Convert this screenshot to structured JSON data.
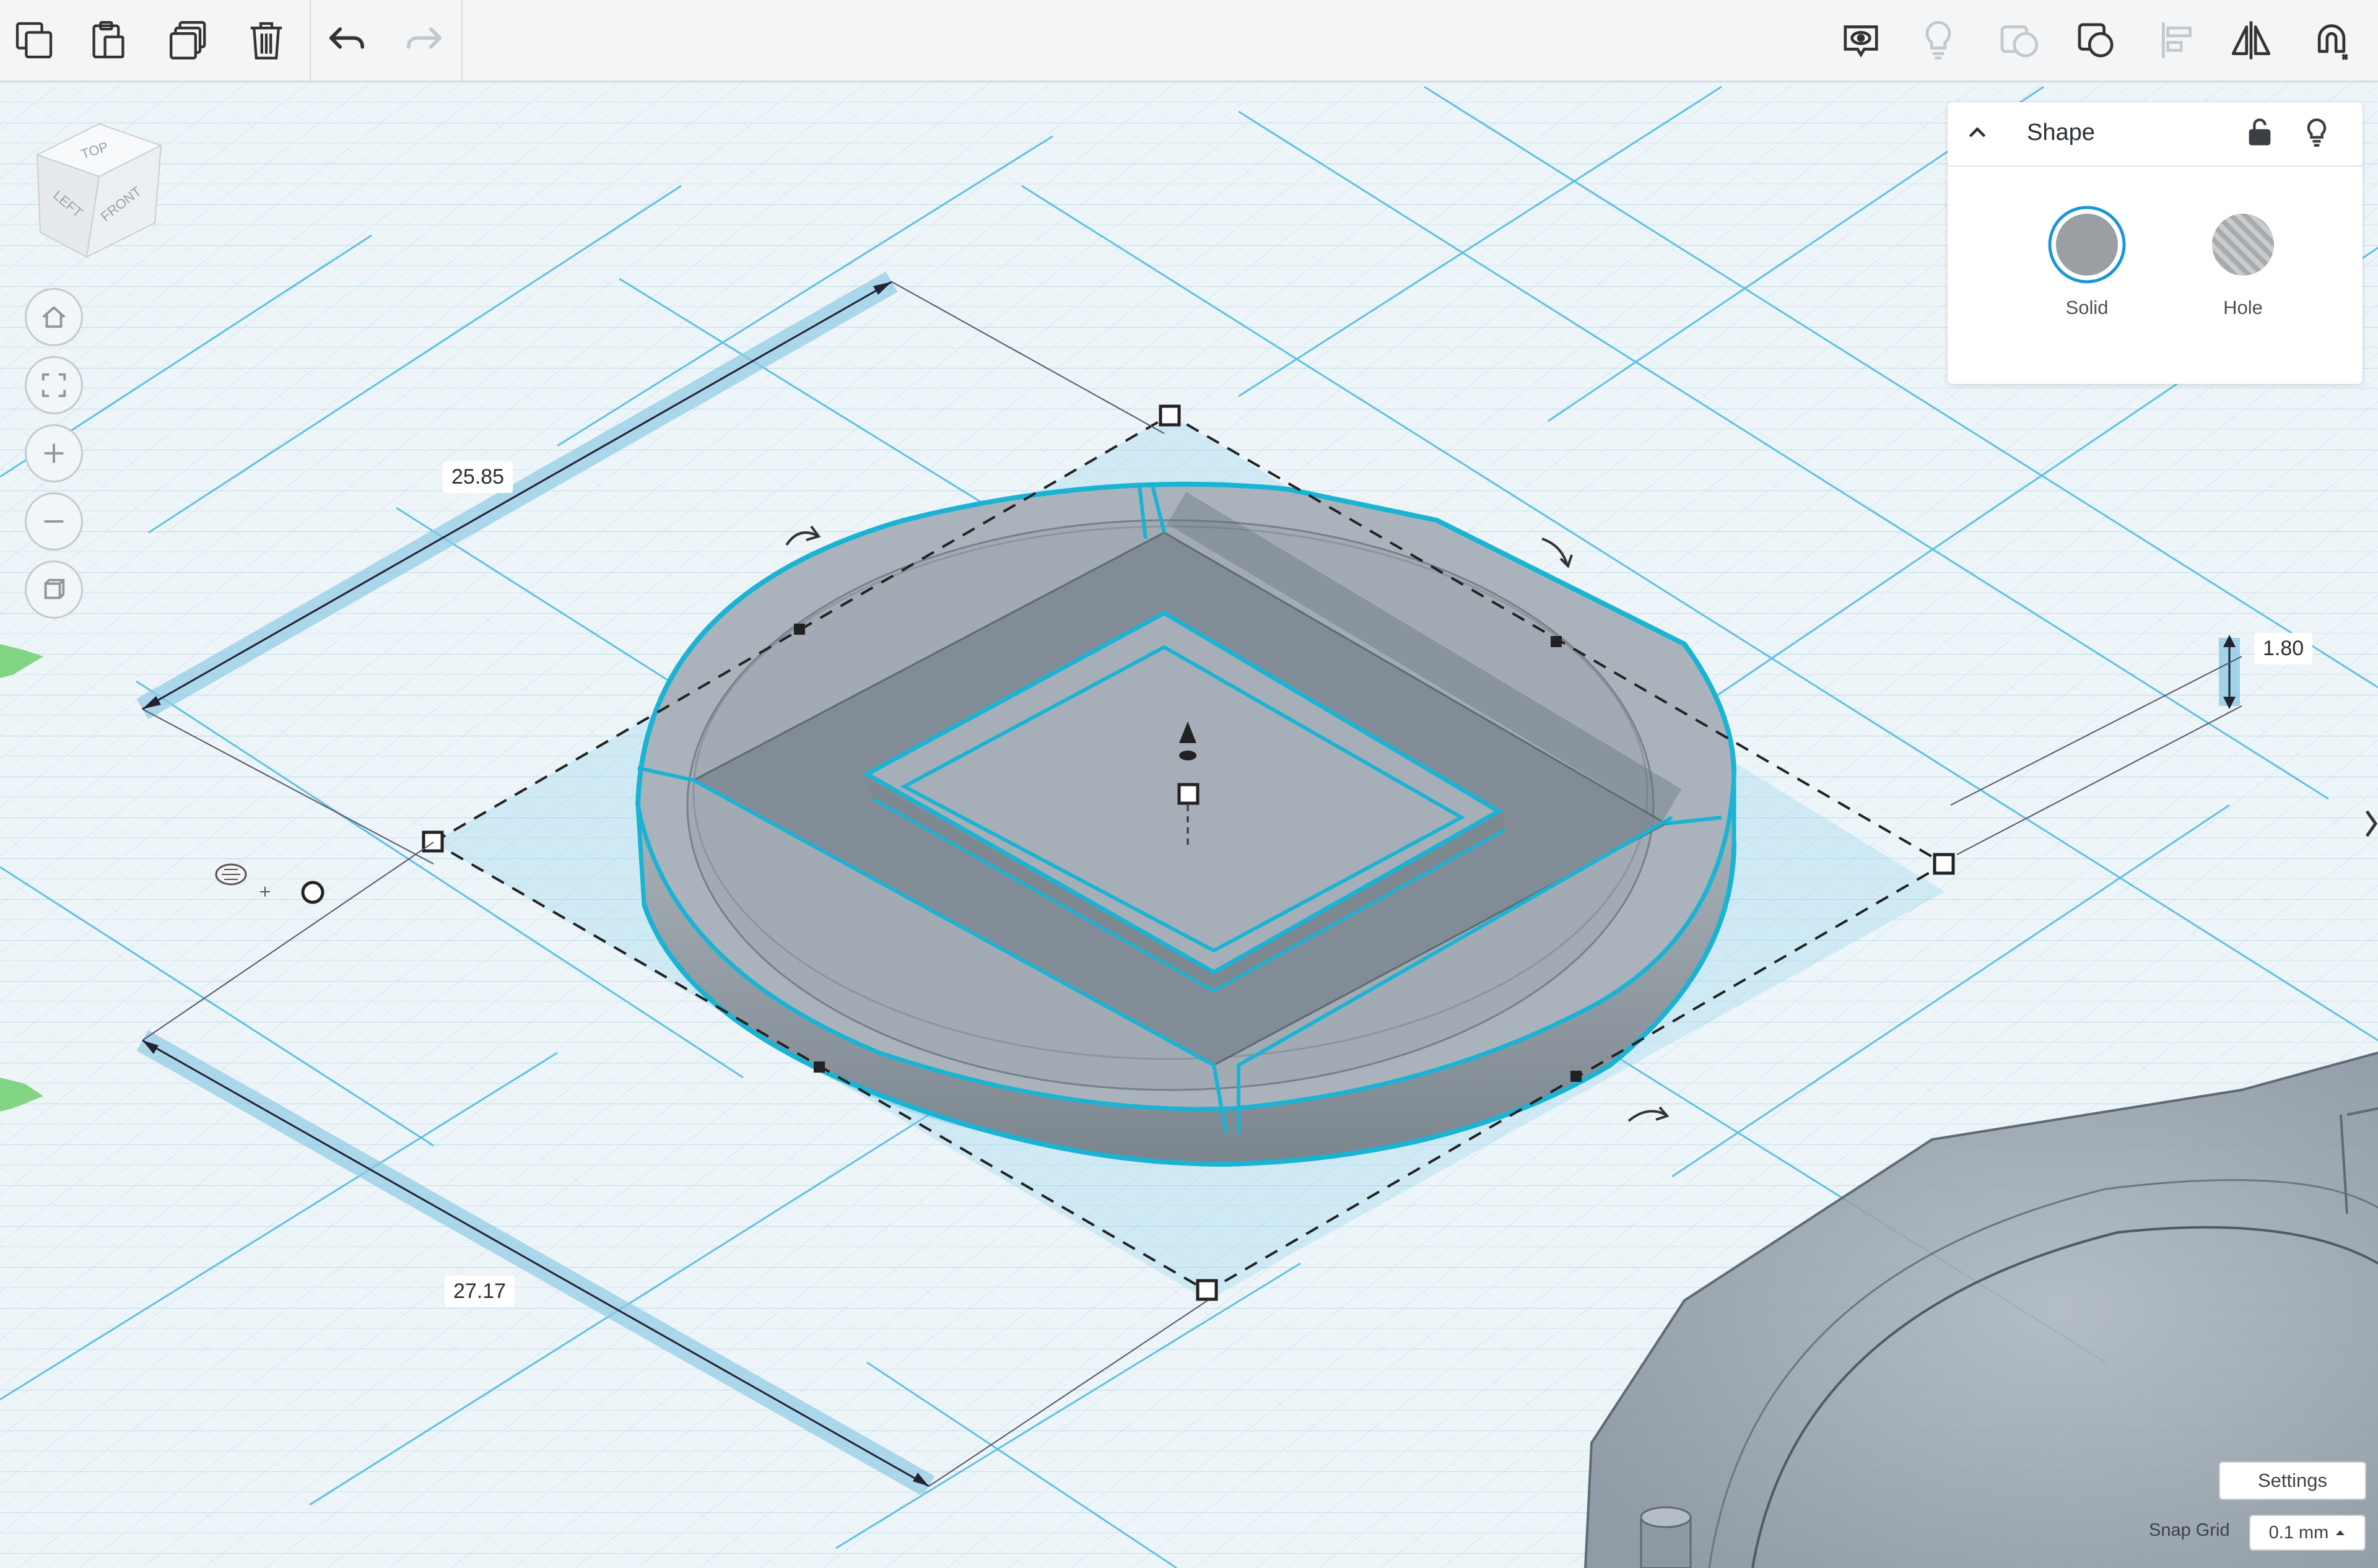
{
  "toolbar": {
    "left_icons": [
      "copy-icon",
      "paste-icon",
      "duplicate-icon",
      "delete-icon",
      "undo-icon",
      "redo-icon"
    ],
    "right_icons": [
      "show-all-icon",
      "lightbulb-icon",
      "group-icon",
      "ungroup-icon",
      "align-icon",
      "mirror-icon",
      "magnet-icon"
    ]
  },
  "viewcube": {
    "top": "TOP",
    "left": "LEFT",
    "front": "FRONT"
  },
  "navigation": [
    "home-icon",
    "fit-view-icon",
    "zoom-in-icon",
    "zoom-out-icon",
    "ortho-view-icon"
  ],
  "inspector": {
    "title": "Shape",
    "solid_label": "Solid",
    "hole_label": "Hole"
  },
  "dimensions": {
    "length": "25.85",
    "width": "27.17",
    "height": "1.80"
  },
  "footer": {
    "settings_label": "Settings",
    "snap_grid_label": "Snap Grid",
    "snap_grid_value": "0.1 mm"
  },
  "colors": {
    "selection": "#1ab3d4",
    "shape_fill": "#8a939b",
    "grid_minor": "#c3dbe6",
    "grid_major": "#48b8de"
  }
}
